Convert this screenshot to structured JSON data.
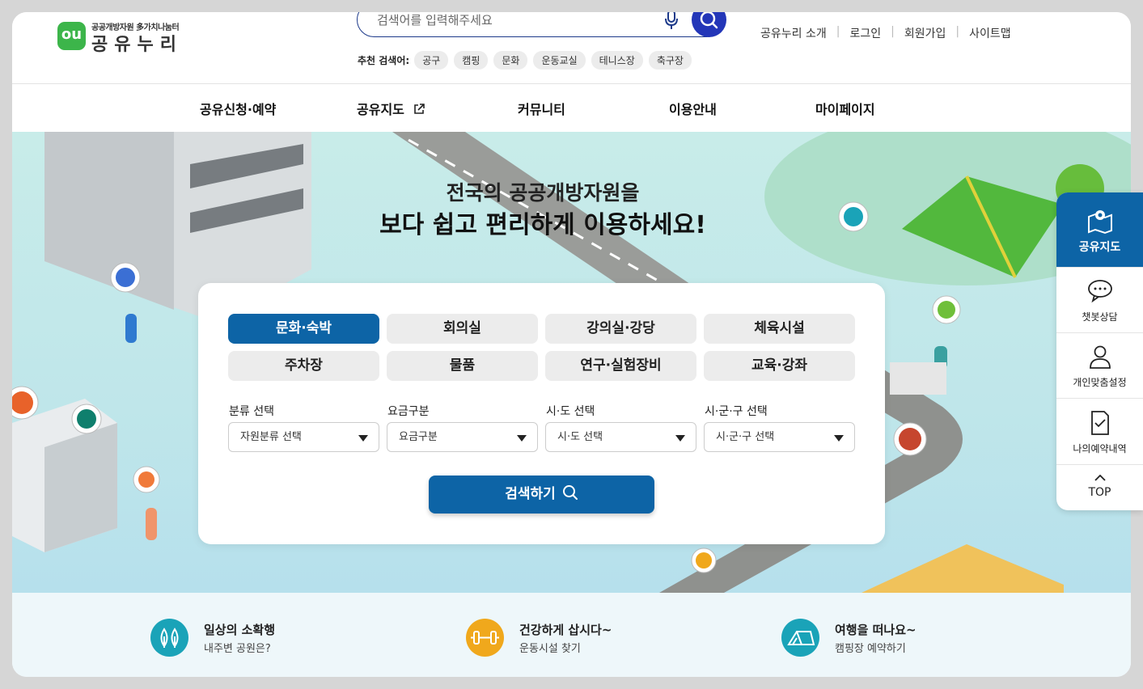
{
  "logo": {
    "mark": "ou",
    "subtitle": "공공개방자원 多가치나눔터",
    "title": "공유누리"
  },
  "search": {
    "placeholder": "검색어를 입력해주세요"
  },
  "recommend": {
    "label": "추천 검색어:",
    "keywords": [
      "공구",
      "캠핑",
      "문화",
      "운동교실",
      "테니스장",
      "축구장"
    ]
  },
  "util_links": [
    "공유누리 소개",
    "로그인",
    "회원가입",
    "사이트맵"
  ],
  "nav": [
    "공유신청·예약",
    "공유지도",
    "커뮤니티",
    "이용안내",
    "마이페이지"
  ],
  "hero": {
    "title1": "전국의 공공개방자원을",
    "title2": "보다 쉽고 편리하게 이용하세요!"
  },
  "categories": [
    "문화·숙박",
    "회의실",
    "강의실·강당",
    "체육시설",
    "주차장",
    "물품",
    "연구·실험장비",
    "교육·강좌"
  ],
  "active_category": "문화·숙박",
  "filters": [
    {
      "label": "분류 선택",
      "value": "자원분류 선택"
    },
    {
      "label": "요금구분",
      "value": "요금구분"
    },
    {
      "label": "시·도 선택",
      "value": "시·도 선택"
    },
    {
      "label": "시·군·구 선택",
      "value": "시·군·구 선택"
    }
  ],
  "search_button": "검색하기",
  "shortcuts": [
    {
      "title": "일상의 소확행",
      "subtitle": "내주변 공원은?",
      "color": "#1aa3b8",
      "icon": "park-icon"
    },
    {
      "title": "건강하게 삽시다~",
      "subtitle": "운동시설 찾기",
      "color": "#f0a81c",
      "icon": "dumbbell-icon"
    },
    {
      "title": "여행을 떠나요~",
      "subtitle": "캠핑장 예약하기",
      "color": "#1aa3b8",
      "icon": "tent-icon"
    }
  ],
  "quick_menu": [
    "공유지도",
    "챗봇상담",
    "개인맞춤설정",
    "나의예약내역",
    "TOP"
  ],
  "colors": {
    "primary": "#0d64a6",
    "search_button": "#2336b8",
    "brand_green": "#3cb54a"
  }
}
